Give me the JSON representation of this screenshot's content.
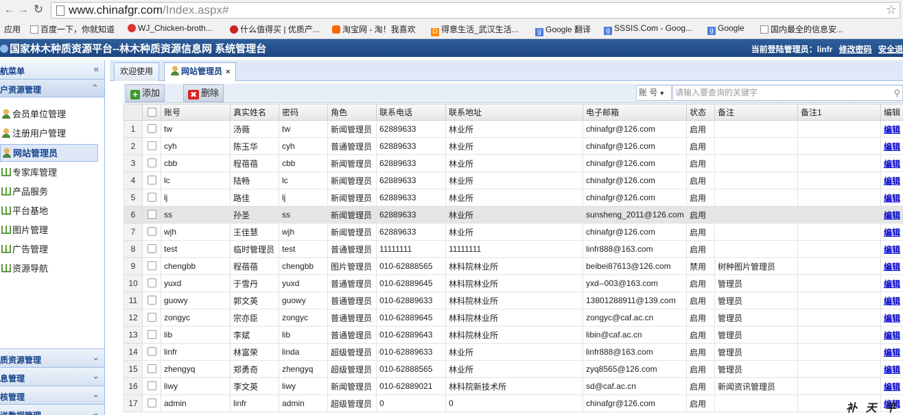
{
  "browser": {
    "url_host": "www.chinafgr.com",
    "url_path": "/Index.aspx#",
    "bookmarks": [
      {
        "icon": "apps-icon",
        "label": "应用"
      },
      {
        "icon": "page-icon",
        "label": "百度一下，你就知道"
      },
      {
        "icon": "weibo-icon",
        "label": "WJ_Chicken-broth..."
      },
      {
        "icon": "smzdm-icon",
        "label": "什么值得买 | 优质产..."
      },
      {
        "icon": "taobao-icon",
        "label": "淘宝网 - 淘！我喜欢"
      },
      {
        "icon": "d-icon",
        "label": "得意生活_武汉生活..."
      },
      {
        "icon": "google-icon",
        "label": "Google 翻译"
      },
      {
        "icon": "google-icon",
        "label": "SSSIS.Com - Goog..."
      },
      {
        "icon": "google-icon",
        "label": "Google"
      },
      {
        "icon": "page-icon",
        "label": "国内最全的信息安..."
      }
    ]
  },
  "header": {
    "title": "国家林木种质资源平台--林木种质资源信息网 系统管理台",
    "login_label": "当前登陆管理员：",
    "login_user": "linfr",
    "change_password": "修改密码",
    "logout": "安全退"
  },
  "sidebar": {
    "head": "航菜单",
    "section": "户资源管理",
    "items": [
      {
        "icon": "user-icon",
        "label": "会员单位管理"
      },
      {
        "icon": "user-icon",
        "label": "注册用户管理"
      },
      {
        "icon": "user-icon",
        "label": "网站管理员"
      },
      {
        "icon": "book-icon",
        "label": "专家库管理"
      },
      {
        "icon": "book-icon",
        "label": "产品服务"
      },
      {
        "icon": "book-icon",
        "label": "平台基地"
      },
      {
        "icon": "book-icon",
        "label": "图片管理"
      },
      {
        "icon": "book-icon",
        "label": "广告管理"
      },
      {
        "icon": "book-icon",
        "label": "资源导航"
      }
    ],
    "footer": [
      "质资源管理",
      "息管理",
      "核管理",
      "送数据管理"
    ]
  },
  "tabs": {
    "welcome": "欢迎使用",
    "admin": "网站管理员"
  },
  "toolbar": {
    "add": "添加",
    "delete": "删除",
    "search_field": "账 号",
    "search_placeholder": "请输入要查询的关键字"
  },
  "grid": {
    "columns": [
      "账号",
      "真实姓名",
      "密码",
      "角色",
      "联系电话",
      "联系地址",
      "电子邮箱",
      "状态",
      "备注",
      "备注1",
      "编辑"
    ],
    "edit_label": "编辑",
    "rows": [
      {
        "n": "1",
        "account": "tw",
        "name": "汤薇",
        "pwd": "tw",
        "role": "新闻管理员",
        "phone": "62889633",
        "addr": "林业所",
        "email": "chinafgr@126.com",
        "status": "启用",
        "note": ""
      },
      {
        "n": "2",
        "account": "cyh",
        "name": "陈玉华",
        "pwd": "cyh",
        "role": "普通管理员",
        "phone": "62889633",
        "addr": "林业所",
        "email": "chinafgr@126.com",
        "status": "启用",
        "note": ""
      },
      {
        "n": "3",
        "account": "cbb",
        "name": "程蓓蓓",
        "pwd": "cbb",
        "role": "新闻管理员",
        "phone": "62889633",
        "addr": "林业所",
        "email": "chinafgr@126.com",
        "status": "启用",
        "note": ""
      },
      {
        "n": "4",
        "account": "lc",
        "name": "陆畅",
        "pwd": "lc",
        "role": "新闻管理员",
        "phone": "62889633",
        "addr": "林业所",
        "email": "chinafgr@126.com",
        "status": "启用",
        "note": ""
      },
      {
        "n": "5",
        "account": "lj",
        "name": "路佳",
        "pwd": "lj",
        "role": "新闻管理员",
        "phone": "62889633",
        "addr": "林业所",
        "email": "chinafgr@126.com",
        "status": "启用",
        "note": ""
      },
      {
        "n": "6",
        "account": "ss",
        "name": "孙圣",
        "pwd": "ss",
        "role": "新闻管理员",
        "phone": "62889633",
        "addr": "林业所",
        "email": "sunsheng_2011@126.com",
        "status": "启用",
        "note": ""
      },
      {
        "n": "7",
        "account": "wjh",
        "name": "王佳慧",
        "pwd": "wjh",
        "role": "新闻管理员",
        "phone": "62889633",
        "addr": "林业所",
        "email": "chinafgr@126.com",
        "status": "启用",
        "note": ""
      },
      {
        "n": "8",
        "account": "test",
        "name": "临时管理员",
        "pwd": "test",
        "role": "普通管理员",
        "phone": "11111111",
        "addr": "11111111",
        "email": "linfr888@163.com",
        "status": "启用",
        "note": ""
      },
      {
        "n": "9",
        "account": "chengbb",
        "name": "程蓓蓓",
        "pwd": "chengbb",
        "role": "图片管理员",
        "phone": "010-62888565",
        "addr": "林科院林业所",
        "email": "beibei87613@126.com",
        "status": "禁用",
        "note": "树种图片管理员"
      },
      {
        "n": "10",
        "account": "yuxd",
        "name": "于雪丹",
        "pwd": "yuxd",
        "role": "普通管理员",
        "phone": "010-62889645",
        "addr": "林科院林业所",
        "email": "yxd--003@163.com",
        "status": "启用",
        "note": "管理员"
      },
      {
        "n": "11",
        "account": "guowy",
        "name": "郭文英",
        "pwd": "guowy",
        "role": "普通管理员",
        "phone": "010-62889633",
        "addr": "林科院林业所",
        "email": "13801288911@139.com",
        "status": "启用",
        "note": "管理员"
      },
      {
        "n": "12",
        "account": "zongyc",
        "name": "宗亦臣",
        "pwd": "zongyc",
        "role": "普通管理员",
        "phone": "010-62889645",
        "addr": "林科院林业所",
        "email": "zongyc@caf.ac.cn",
        "status": "启用",
        "note": "管理员"
      },
      {
        "n": "13",
        "account": "lib",
        "name": "李斌",
        "pwd": "lib",
        "role": "普通管理员",
        "phone": "010-62889643",
        "addr": "林科院林业所",
        "email": "libin@caf.ac.cn",
        "status": "启用",
        "note": "管理员"
      },
      {
        "n": "14",
        "account": "linfr",
        "name": "林富荣",
        "pwd": "linda",
        "role": "超级管理员",
        "phone": "010-62889633",
        "addr": "林业所",
        "email": "linfr888@163.com",
        "status": "启用",
        "note": "管理员"
      },
      {
        "n": "15",
        "account": "zhengyq",
        "name": "郑勇奇",
        "pwd": "zhengyq",
        "role": "超级管理员",
        "phone": "010-62888565",
        "addr": "林业所",
        "email": "zyq8565@126.com",
        "status": "启用",
        "note": "管理员"
      },
      {
        "n": "16",
        "account": "liwy",
        "name": "李文英",
        "pwd": "liwy",
        "role": "新闻管理员",
        "phone": "010-62889021",
        "addr": "林科院新技术所",
        "email": "sd@caf.ac.cn",
        "status": "启用",
        "note": "新闻资讯管理员"
      },
      {
        "n": "17",
        "account": "admin",
        "name": "linfr",
        "pwd": "admin",
        "role": "超级管理员",
        "phone": "0",
        "addr": "0",
        "email": "chinafgr@126.com",
        "status": "启用",
        "note": ""
      }
    ]
  },
  "watermark": "补 天 平 台"
}
